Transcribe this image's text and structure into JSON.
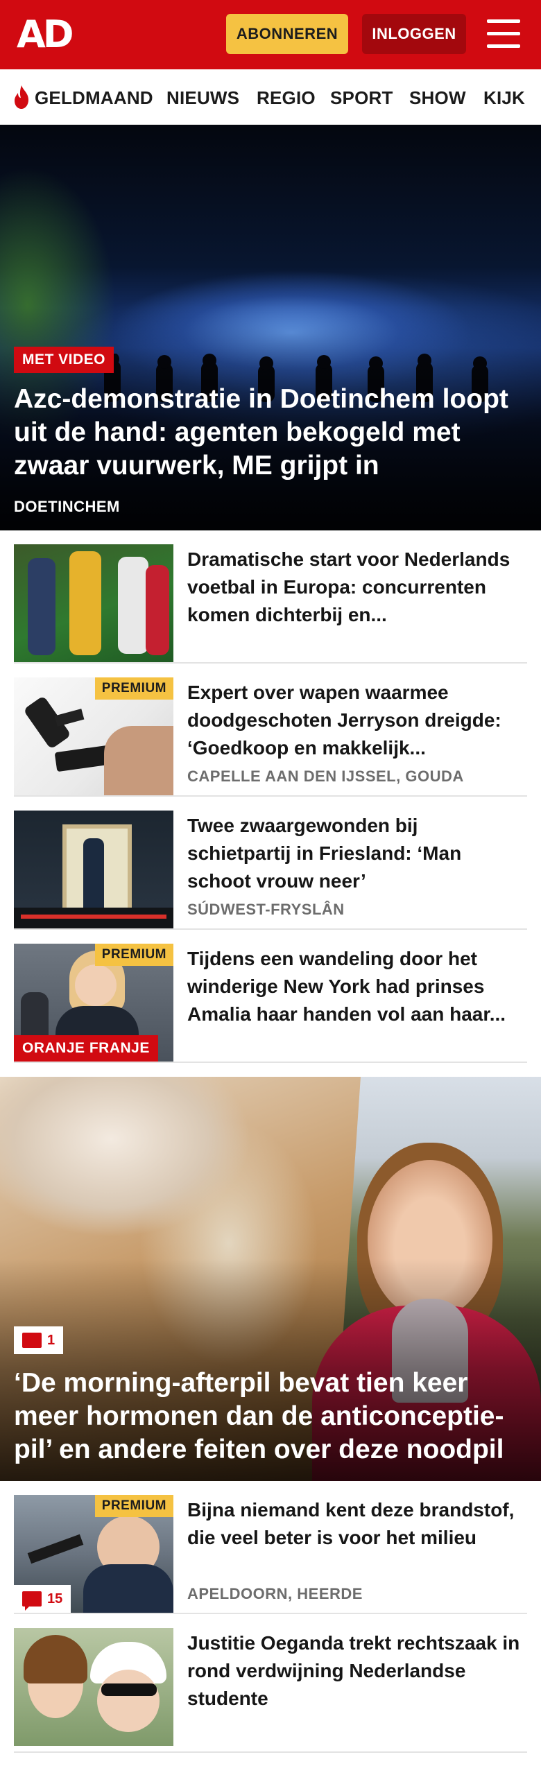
{
  "header": {
    "logo": "AD",
    "subscribe_label": "ABONNEREN",
    "login_label": "INLOGGEN",
    "menu_icon": "hamburger-icon"
  },
  "nav": {
    "items": [
      {
        "label": "GELDMAAND",
        "icon": "flame-icon"
      },
      {
        "label": "NIEUWS"
      },
      {
        "label": "REGIO"
      },
      {
        "label": "SPORT"
      },
      {
        "label": "SHOW"
      },
      {
        "label": "KIJK"
      }
    ]
  },
  "hero": {
    "badge": "MET VIDEO",
    "title": "Azc-demonstratie in Doetinchem loopt uit de hand: agenten bekogeld met zwaar vuurwerk, ME grijpt in",
    "location": "DOETINCHEM"
  },
  "articles": [
    {
      "title": "Dramatische start voor Nederlands voetbal in Europa: concurrenten komen dichterbij en...",
      "location": "",
      "premium": "",
      "badge": ""
    },
    {
      "title": "Expert over wapen waarmee doodgeschoten Jerryson dreigde: ‘Goedkoop en makkelijk...",
      "location": "CAPELLE AAN DEN IJSSEL, GOUDA",
      "premium": "PREMIUM",
      "badge": ""
    },
    {
      "title": "Twee zwaargewonden bij schietpartij in Friesland: ‘Man schoot vrouw neer’",
      "location": "SÚDWEST-FRYSLÂN",
      "premium": "",
      "badge": ""
    },
    {
      "title": "Tijdens een wandeling door het winderige New York had prinses Amalia haar handen vol aan haar...",
      "location": "",
      "premium": "PREMIUM",
      "badge": "ORANJE FRANJE"
    }
  ],
  "hero2": {
    "comment_count": "1",
    "title": "‘De morning-afterpil bevat tien keer meer hormonen dan de anticonceptie-pil’ en andere feiten over deze noodpil"
  },
  "articles2": [
    {
      "title": "Bijna niemand kent deze brandstof, die veel beter is voor het milieu",
      "location": "APELDOORN, HEERDE",
      "premium": "PREMIUM",
      "comment_count": "15"
    },
    {
      "title": "Justitie Oeganda trekt rechtszaak in rond verdwijning Nederlandse studente",
      "location": "",
      "premium": "",
      "comment_count": ""
    }
  ],
  "colors": {
    "brand_red": "#d10a11",
    "premium_yellow": "#f5c242",
    "login_dark_red": "#a3080d"
  }
}
